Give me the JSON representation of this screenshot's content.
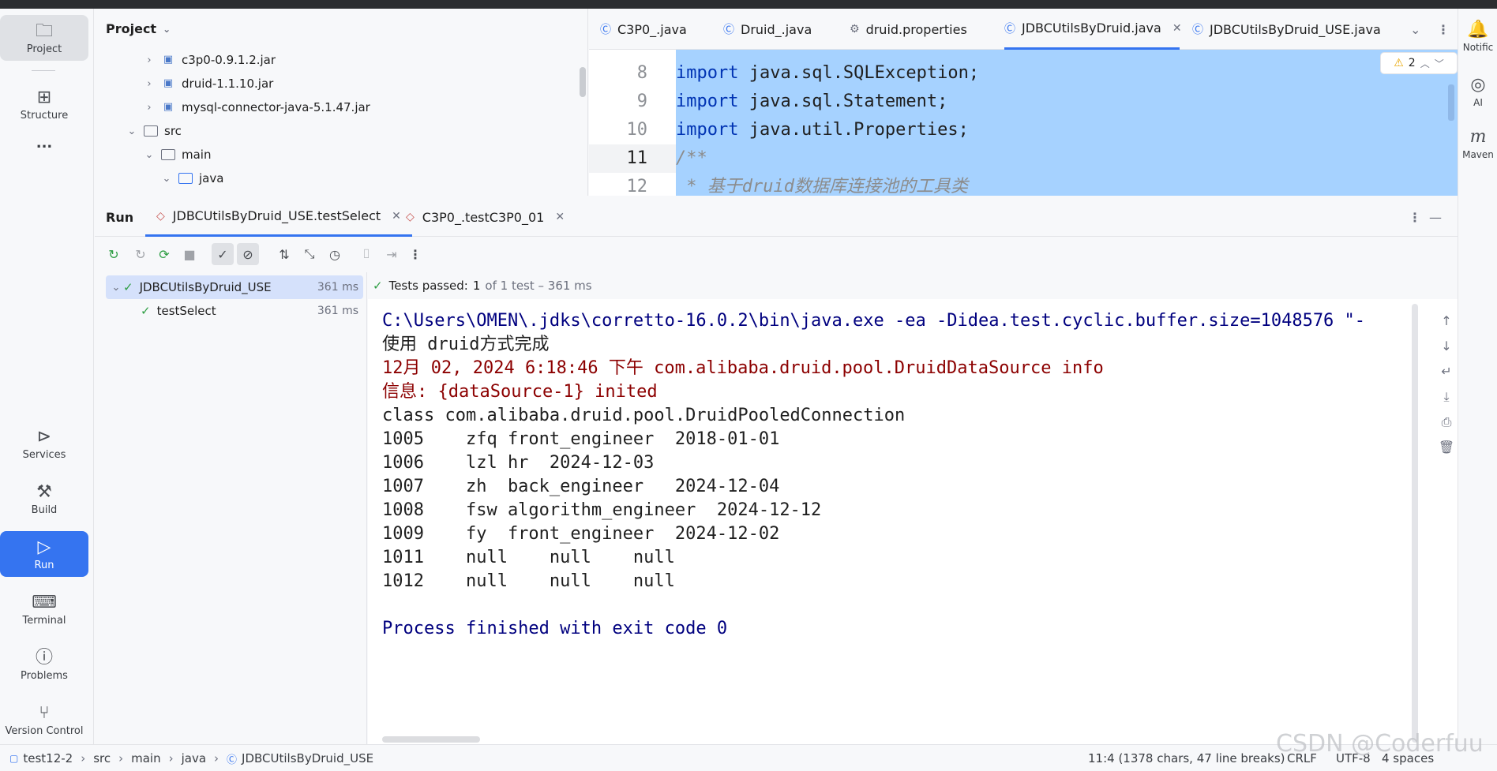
{
  "left_toolbar": {
    "project": "Project",
    "structure": "Structure",
    "more": "...",
    "services": "Services",
    "build": "Build",
    "run": "Run",
    "terminal": "Terminal",
    "problems": "Problems",
    "version_control": "Version Control"
  },
  "right_toolbar": {
    "notifications": "Notific",
    "ai": "AI",
    "maven": "Maven"
  },
  "project_panel": {
    "title": "Project",
    "tree": [
      {
        "label": "c3p0-0.9.1.2.jar"
      },
      {
        "label": "druid-1.1.10.jar"
      },
      {
        "label": "mysql-connector-java-5.1.47.jar"
      },
      {
        "label": "src"
      },
      {
        "label": "main"
      },
      {
        "label": "java"
      }
    ]
  },
  "editor_tabs": [
    {
      "label": "C3P0_.java"
    },
    {
      "label": "Druid_.java"
    },
    {
      "label": "druid.properties"
    },
    {
      "label": "JDBCUtilsByDruid.java"
    },
    {
      "label": "JDBCUtilsByDruid_USE.java"
    }
  ],
  "editor": {
    "warning_count": "2",
    "lines": [
      {
        "num": "8",
        "kw": "import",
        "rest": " java.sql.SQLException;"
      },
      {
        "num": "9",
        "kw": "import",
        "rest": " java.sql.Statement;"
      },
      {
        "num": "10",
        "kw": "import",
        "rest": " java.util.Properties;"
      },
      {
        "num": "11",
        "kw": "",
        "rest": "/**"
      },
      {
        "num": "12",
        "kw": "",
        "rest": " * 基于druid数据库连接池的工具类"
      }
    ]
  },
  "run_panel": {
    "title": "Run",
    "tabs": [
      {
        "label": "JDBCUtilsByDruid_USE.testSelect"
      },
      {
        "label": "C3P0_.testC3P0_01"
      }
    ],
    "tests": [
      {
        "name": "JDBCUtilsByDruid_USE",
        "time": "361 ms"
      },
      {
        "name": "testSelect",
        "time": "361 ms"
      }
    ],
    "status_prefix": "Tests passed:",
    "status_count": "1",
    "status_suffix": "of 1 test – 361 ms",
    "console": [
      {
        "text": "C:\\Users\\OMEN\\.jdks\\corretto-16.0.2\\bin\\java.exe -ea -Didea.test.cyclic.buffer.size=1048576 \"-",
        "color": "navy"
      },
      {
        "text": "使用 druid方式完成",
        "color": "black"
      },
      {
        "text": "12月 02, 2024 6:18:46 下午 com.alibaba.druid.pool.DruidDataSource info",
        "color": "red"
      },
      {
        "text": "信息: {dataSource-1} inited",
        "color": "red"
      },
      {
        "text": "class com.alibaba.druid.pool.DruidPooledConnection",
        "color": "black"
      },
      {
        "text": "1005    zfq front_engineer  2018-01-01",
        "color": "black"
      },
      {
        "text": "1006    lzl hr  2024-12-03",
        "color": "black"
      },
      {
        "text": "1007    zh  back_engineer   2024-12-04",
        "color": "black"
      },
      {
        "text": "1008    fsw algorithm_engineer  2024-12-12",
        "color": "black"
      },
      {
        "text": "1009    fy  front_engineer  2024-12-02",
        "color": "black"
      },
      {
        "text": "1011    null    null    null",
        "color": "black"
      },
      {
        "text": "1012    null    null    null",
        "color": "black"
      },
      {
        "text": "",
        "color": "black"
      },
      {
        "text": "Process finished with exit code 0",
        "color": "navy"
      }
    ]
  },
  "status_bar": {
    "crumbs": [
      "test12-2",
      "src",
      "main",
      "java",
      "JDBCUtilsByDruid_USE"
    ],
    "position": "11:4 (1378 chars, 47 line breaks)",
    "line_sep": "CRLF",
    "encoding": "UTF-8",
    "indent": "4 spaces"
  },
  "watermark": "CSDN @Coderfuu"
}
